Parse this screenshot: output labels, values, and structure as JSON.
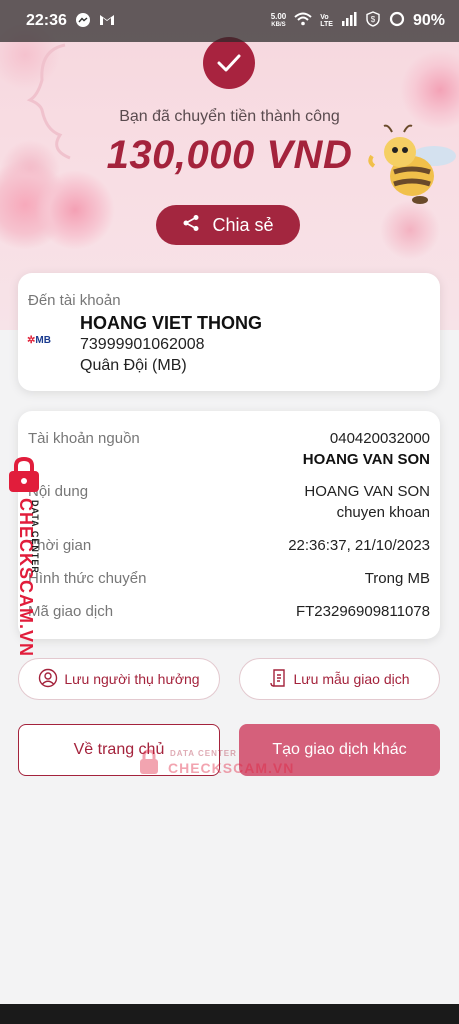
{
  "status_bar": {
    "time": "22:36",
    "net_speed_top": "5.00",
    "net_speed_bottom": "KB/S",
    "battery": "90%"
  },
  "hero": {
    "success_message": "Bạn đã chuyển tiền thành công",
    "amount": "130,000 VND",
    "share_label": "Chia sẻ"
  },
  "recipient": {
    "label": "Đến tài khoản",
    "bank_logo": "MB",
    "name": "HOANG VIET THONG",
    "account_number": "73999901062008",
    "bank_name": "Quân Đội (MB)"
  },
  "details": {
    "source_label": "Tài khoản nguồn",
    "source_account": "040420032000",
    "source_name": "HOANG VAN SON",
    "content_label": "Nội dung",
    "content_line1": "HOANG VAN SON",
    "content_line2": "chuyen khoan",
    "time_label": "Thời gian",
    "time_value": "22:36:37, 21/10/2023",
    "method_label": "Hình thức chuyển",
    "method_value": "Trong MB",
    "code_label": "Mã giao dịch",
    "code_value": "FT23296909811078"
  },
  "actions": {
    "save_payee": "Lưu người thụ hưởng",
    "save_template": "Lưu mẫu giao dịch",
    "home": "Về trang chủ",
    "new_transaction": "Tạo giao dịch khác"
  },
  "watermark": {
    "vertical_big": "CHECKSCAM.VN",
    "vertical_small": "DATA CENTER",
    "center_small": "DATA CENTER",
    "center_big": "CHECKSCAM.VN"
  },
  "colors": {
    "brand": "#a4233c",
    "primary_button": "#d5607b",
    "watermark": "#e11d3b"
  }
}
